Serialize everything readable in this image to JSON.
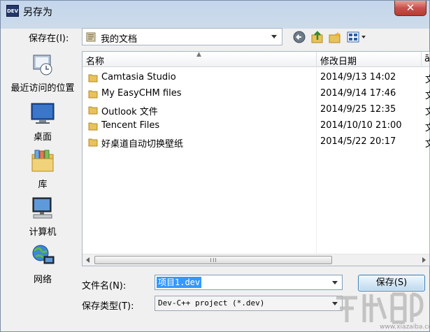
{
  "window": {
    "app_icon_text": "DEV",
    "title": "另存为",
    "close_symbol": "✕"
  },
  "save_in": {
    "label": "保存在(I):",
    "value": "我的文档"
  },
  "toolbar": {
    "icons": [
      "back-icon",
      "up-folder-icon",
      "new-folder-icon",
      "view-menu-icon"
    ]
  },
  "places": [
    {
      "label": "最近访问的位置",
      "icon": "recent-places-icon"
    },
    {
      "label": "桌面",
      "icon": "desktop-icon"
    },
    {
      "label": "库",
      "icon": "libraries-icon"
    },
    {
      "label": "计算机",
      "icon": "computer-icon"
    },
    {
      "label": "网络",
      "icon": "network-icon"
    }
  ],
  "file_list": {
    "columns": {
      "name": "名称",
      "date": "修改日期",
      "extra": "ā"
    },
    "rows": [
      {
        "name": "Camtasia Studio",
        "date": "2014/9/13 14:02",
        "extra": "文"
      },
      {
        "name": "My EasyCHM files",
        "date": "2014/9/14 17:46",
        "extra": "文"
      },
      {
        "name": "Outlook 文件",
        "date": "2014/9/25 12:35",
        "extra": "文"
      },
      {
        "name": "Tencent Files",
        "date": "2014/10/10 21:00",
        "extra": "文"
      },
      {
        "name": "好桌道自动切换壁纸",
        "date": "2014/5/22 20:17",
        "extra": "文"
      }
    ]
  },
  "file_name": {
    "label": "文件名(N):",
    "value": "项目1.dev"
  },
  "file_type": {
    "label": "保存类型(T):",
    "value": "Dev-C++ project (*.dev)"
  },
  "buttons": {
    "save": "保存(S)"
  },
  "watermark": {
    "url": "www.xiazaiba.com"
  },
  "colors": {
    "selection": "#3399ff",
    "folder": "#e8c25a",
    "close_button": "#c75050"
  }
}
